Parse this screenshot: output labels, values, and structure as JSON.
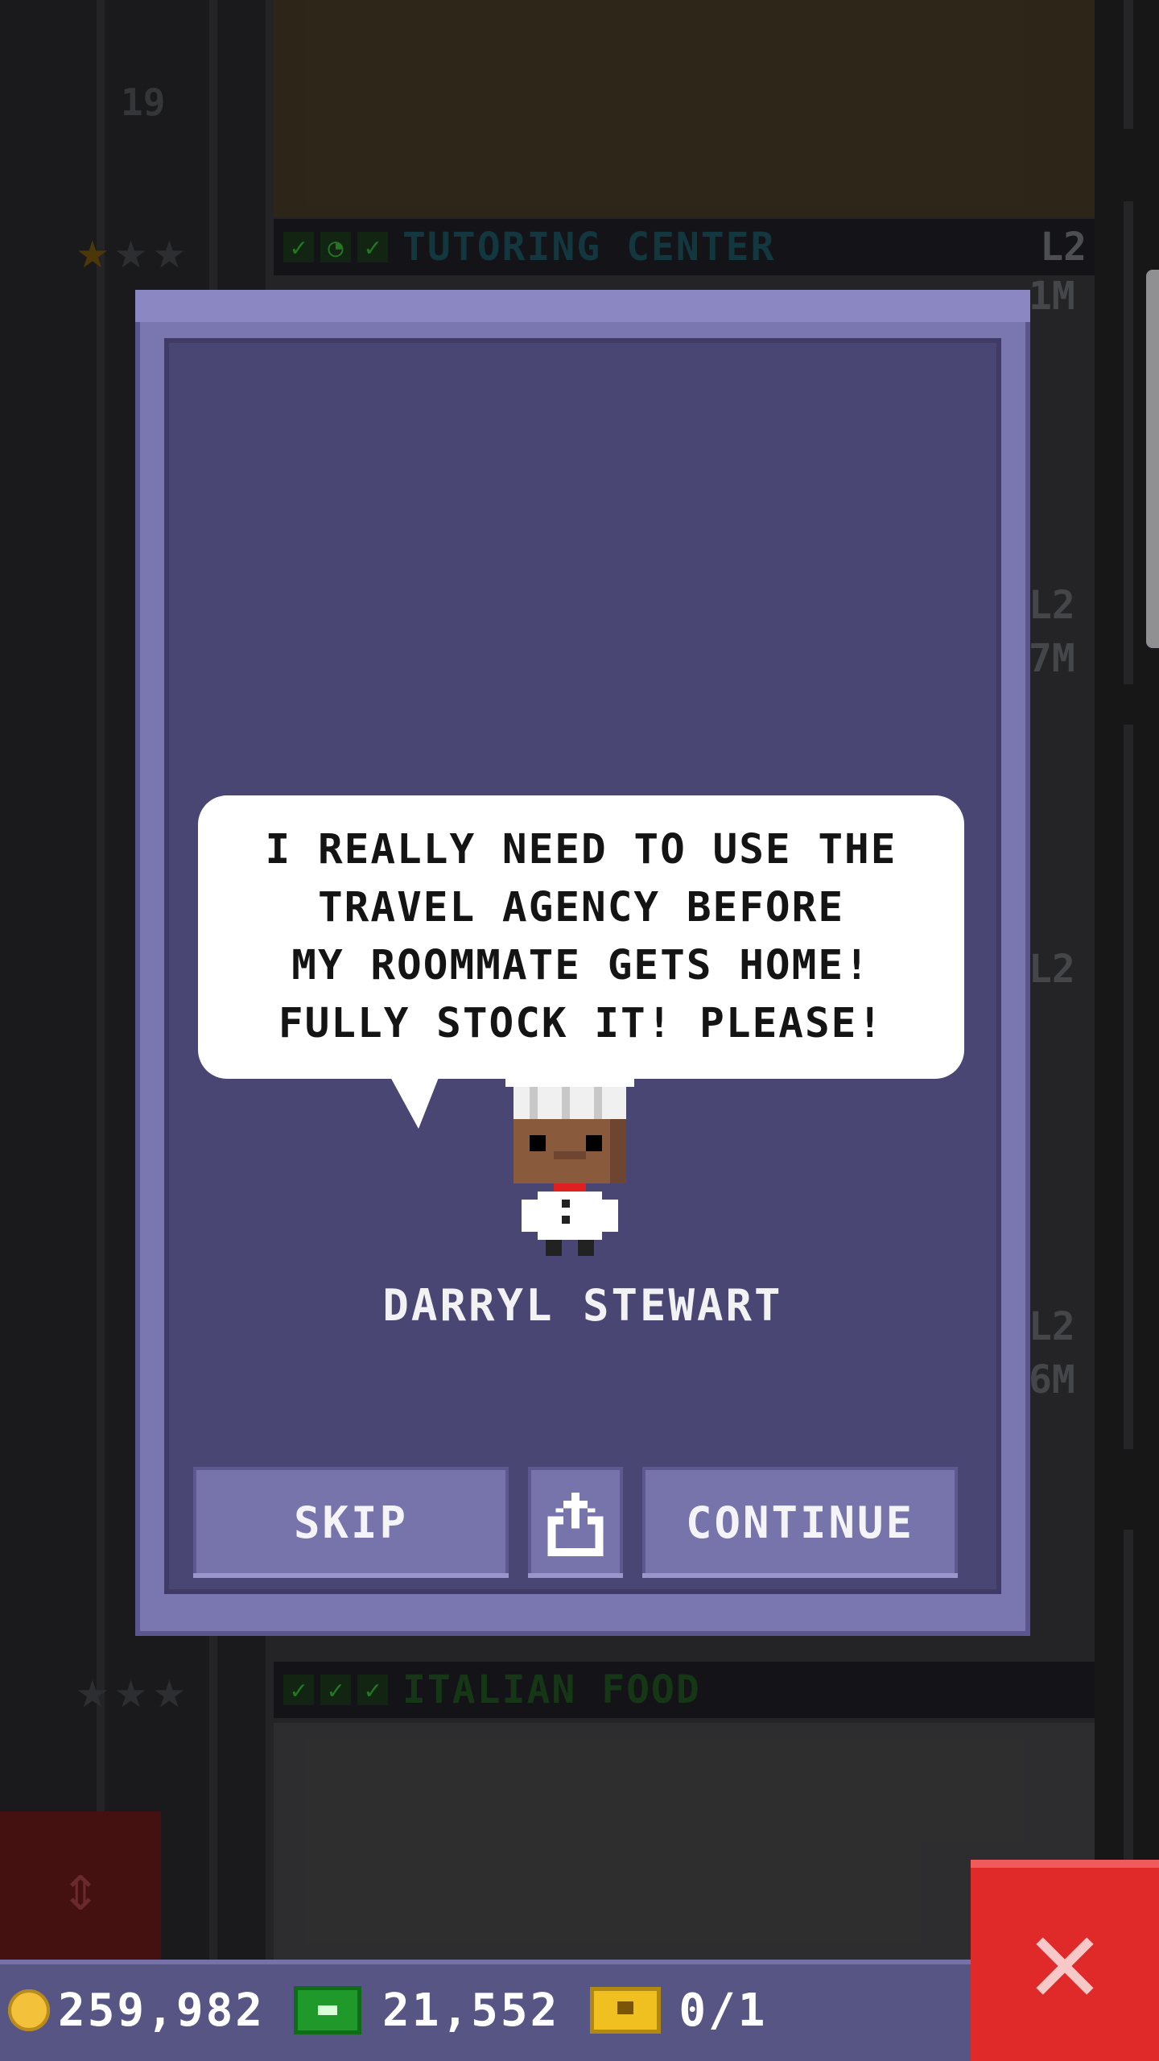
{
  "background": {
    "floor_number": "19",
    "floors": [
      {
        "name": "TUTORING CENTER",
        "level": "L2",
        "name_color": "#1f5a64"
      },
      {
        "name": "ITALIAN FOOD",
        "level": "",
        "name_color": "#235a23"
      }
    ],
    "side_letters": [
      "1M",
      "L2",
      "7M",
      "L2",
      "L2",
      "6M"
    ]
  },
  "dialog": {
    "speech": "I REALLY NEED TO USE THE\nTRAVEL AGENCY BEFORE\nMY ROOMMATE GETS HOME!\nFULLY STOCK IT! PLEASE!",
    "character_name": "DARRYL STEWART",
    "buttons": {
      "skip": "SKIP",
      "share_icon": "share-icon",
      "continue": "CONTINUE"
    }
  },
  "currency": {
    "coins": "259,982",
    "bux": "21,552",
    "tickets": "0/1"
  },
  "colors": {
    "dialog_frame": "#7a76b0",
    "dialog_panel": "#4a4673",
    "close_button": "#e02a2a",
    "currency_bar": "#575584"
  }
}
